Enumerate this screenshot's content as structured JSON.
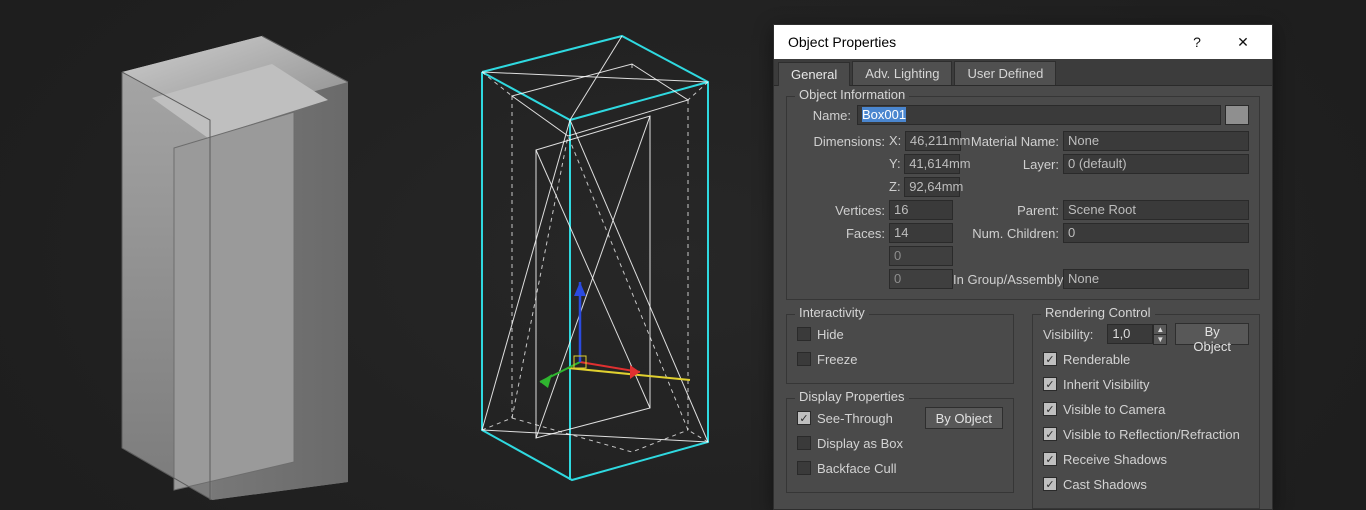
{
  "dialog": {
    "title": "Object Properties",
    "help_icon": "?",
    "close_icon": "✕",
    "tabs": [
      "General",
      "Adv. Lighting",
      "User Defined"
    ],
    "active_tab": 0
  },
  "object_info": {
    "legend": "Object Information",
    "name_label": "Name:",
    "name_value": "Box001",
    "dimensions_label": "Dimensions:",
    "x_label": "X:",
    "x": "46,211mm",
    "y_label": "Y:",
    "y": "41,614mm",
    "z_label": "Z:",
    "z": "92,64mm",
    "vertices_label": "Vertices:",
    "vertices": "16",
    "faces_label": "Faces:",
    "faces": "14",
    "extra1": "0",
    "extra2": "0",
    "material_label": "Material Name:",
    "material": "None",
    "layer_label": "Layer:",
    "layer": "0 (default)",
    "parent_label": "Parent:",
    "parent": "Scene Root",
    "children_label": "Num. Children:",
    "children": "0",
    "group_label": "In Group/Assembly:",
    "group": "None"
  },
  "interactivity": {
    "legend": "Interactivity",
    "hide": "Hide",
    "freeze": "Freeze"
  },
  "display": {
    "legend": "Display Properties",
    "see_through": "See-Through",
    "display_as_box": "Display as Box",
    "backface_cull": "Backface Cull",
    "by_object": "By Object"
  },
  "rendering": {
    "legend": "Rendering Control",
    "visibility_label": "Visibility:",
    "visibility_value": "1,0",
    "by_object": "By Object",
    "renderable": "Renderable",
    "inherit": "Inherit Visibility",
    "visible_camera": "Visible to Camera",
    "visible_refl": "Visible to Reflection/Refraction",
    "receive_shadows": "Receive Shadows",
    "cast_shadows": "Cast Shadows"
  },
  "colors": {
    "selection_cyan": "#2fd9e0",
    "axis_red": "#e03030",
    "axis_green": "#2fb52f",
    "axis_blue": "#2b4be0",
    "axis_yellow": "#e0d02f"
  }
}
